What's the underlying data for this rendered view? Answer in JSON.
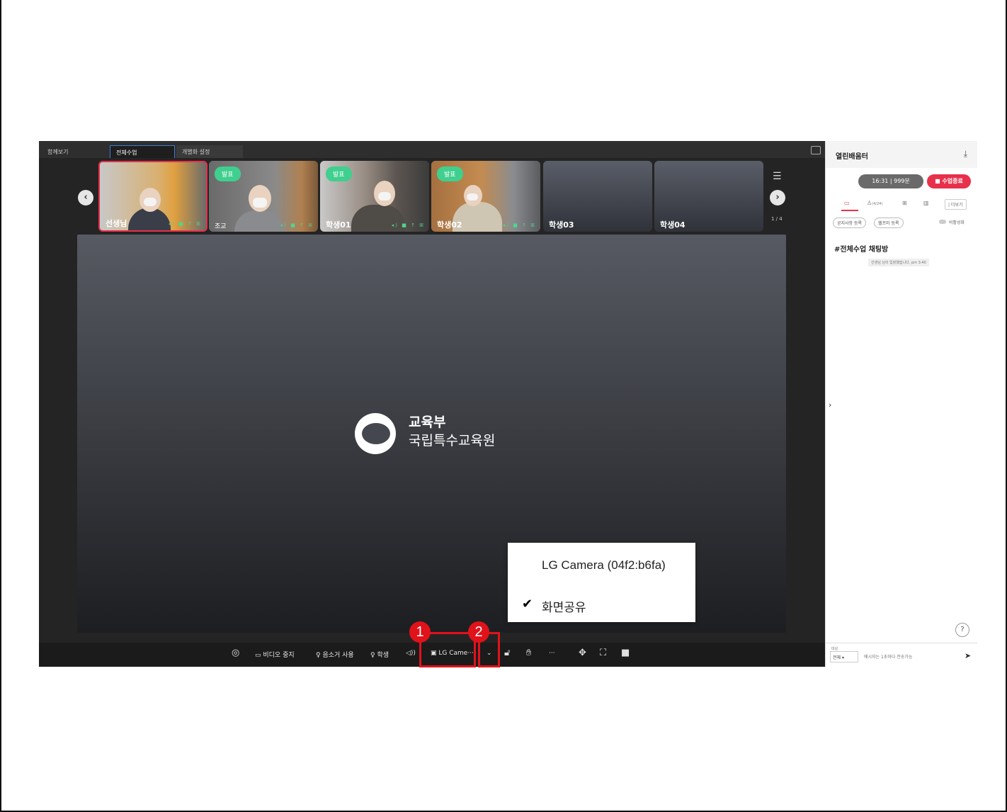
{
  "tabs": [
    "함께보기",
    "전체수업",
    "개별화 설정"
  ],
  "participants": [
    {
      "name": "선생님",
      "badge": "",
      "status": "◂) ■ ↑ ꕤ"
    },
    {
      "name": "조교",
      "badge": "발표",
      "status": "◂) ■ ↑ ꕤ"
    },
    {
      "name": "학생01",
      "badge": "발표",
      "status": "◂) ■ ↑ ꕤ"
    },
    {
      "name": "학생02",
      "badge": "발표",
      "status": "◂) ■ ↑ ꕤ"
    },
    {
      "name": "학생03",
      "badge": "",
      "status": ""
    },
    {
      "name": "학생04",
      "badge": "",
      "status": ""
    }
  ],
  "page_indicator": "1 / 4",
  "stage_logo": {
    "line1": "교육부",
    "line2": "국립특수교육원"
  },
  "controls": {
    "video_stop": "비디오 중지",
    "noise": "음소거 사용",
    "student": "학생",
    "camera": "LG Came···"
  },
  "callouts": [
    "1",
    "2"
  ],
  "dropdown": {
    "options": [
      "LG Camera (04f2:b6fa)",
      "화면공유"
    ],
    "selected": "화면공유"
  },
  "panel": {
    "title": "열린배움터",
    "timer": "16:31  |  999분",
    "end_button": "■ 수업종료",
    "participants_count": "(4/24)",
    "more_button": "| 더보기",
    "notice_button": "공지사항 등록",
    "help_button": "헬프미 등록",
    "toggle_label": "비활성화",
    "chat_title": "#전체수업 채팅방",
    "chat_message": "선생님 님이 입장했습니다. pm 3:40",
    "target_label": "대상",
    "target_value": "전체 ▾",
    "input_placeholder": "메시지는 1초마다 전송가능"
  }
}
